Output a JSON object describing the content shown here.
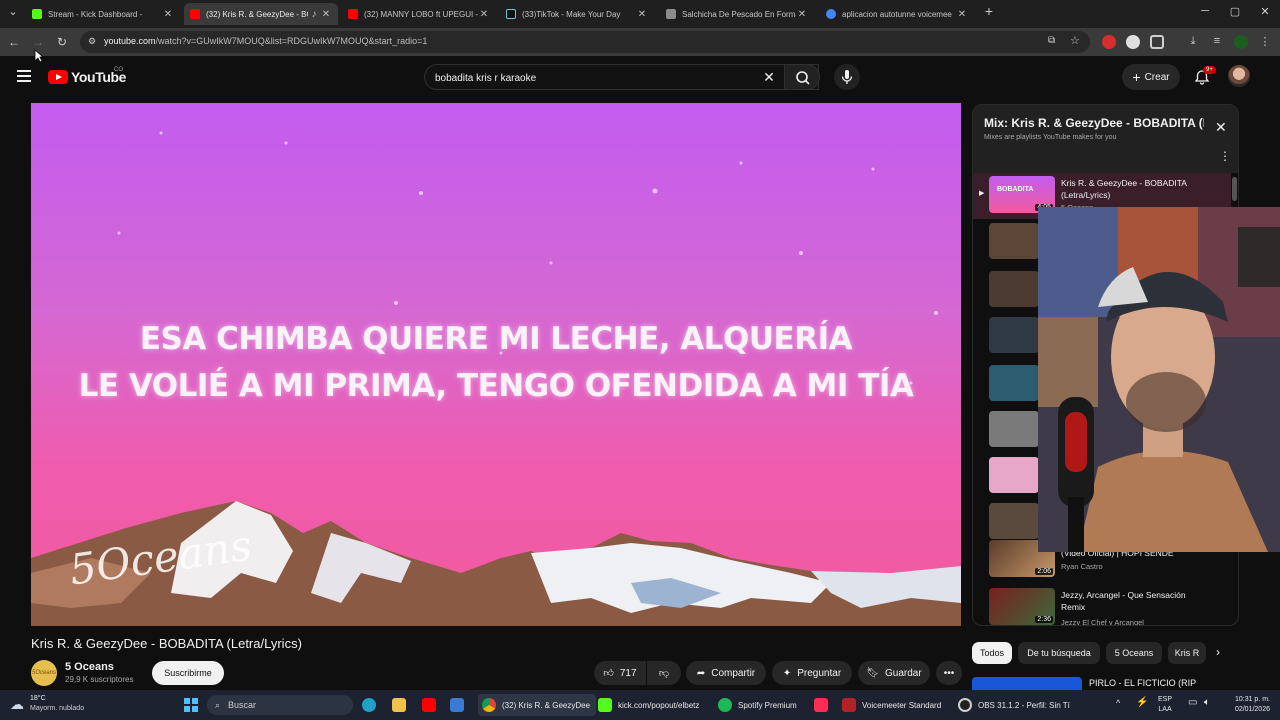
{
  "browser": {
    "tabs": [
      {
        "title": "Stream - Kick Dashboard -",
        "color": "#53fc18"
      },
      {
        "title": "(32) Kris R. & GeezyDee - BO",
        "color": "#ff0000",
        "active": true
      },
      {
        "title": "(32) MANNY LOBO ft UPEGUI -",
        "color": "#ff0000"
      },
      {
        "title": "(33)TikTok - Make Your Day",
        "color": "#ffffff"
      },
      {
        "title": "Salchicha De Pescado En Forma",
        "color": "#ffffff"
      },
      {
        "title": "aplicacion autotunne voicemee",
        "color": "#4285f4"
      }
    ],
    "url_host": "youtube.com",
    "url_path": "/watch?v=GUwIkW7MOUQ&list=RDGUwIkW7MOUQ&start_radio=1"
  },
  "youtube": {
    "logo_text": "YouTube",
    "country": "CO",
    "search_value": "bobadita kris r karaoke",
    "create_label": "Crear",
    "notif_count": "9+"
  },
  "video": {
    "lyric_line1": "ESA CHIMBA QUIERE MI LECHE, ALQUERÍA",
    "lyric_line2": "LE VOLIÉ A MI PRIMA, TENGO OFENDIDA A MI TÍA",
    "watermark": "5Oceans",
    "title": "Kris R. & GeezyDee - BOBADITA (Letra/Lyrics)",
    "channel": "5 Oceans",
    "subscribers": "29,9 K suscriptores",
    "subscribe_label": "Suscribirme",
    "likes": "717",
    "share_label": "Compartir",
    "ask_label": "Preguntar",
    "save_label": "Guardar"
  },
  "playlist": {
    "title": "Mix: Kris R. & GeezyDee - BOBADITA (Letra/Lyrics)",
    "subtitle": "Mixes are playlists YouTube makes for you",
    "items": [
      {
        "title": "Kris R. & GeezyDee - BOBADITA (Letra/Lyrics)",
        "channel": "5 Oceans",
        "duration": "4:05",
        "thumb": "BOBADITA"
      },
      {
        "title": "(Video Oficial) | HOPI SENDÉ",
        "channel": "Ryan Castro",
        "duration": "2:06"
      },
      {
        "title": "Jezzy, Arcangel - Que Sensación Remix",
        "channel": "Jezzy El Chef y Arcangel",
        "duration": "2:36"
      }
    ]
  },
  "chips": [
    "Todos",
    "De tu búsqueda",
    "5 Oceans",
    "Kris R"
  ],
  "next_rec": "PIRLO - EL FICTICIO (RIP",
  "taskbar": {
    "weather_temp": "18°C",
    "weather_desc": "Mayorm. nublado",
    "search_label": "Buscar",
    "apps": [
      {
        "label": "(32) Kris R. & GeezyDee"
      },
      {
        "label": "kick.com/popout/elbetz"
      },
      {
        "label": "Spotify Premium"
      },
      {
        "label": "Voicemeeter Standard"
      },
      {
        "label": "OBS 31.1.2 - Perfil: Sin Tí"
      }
    ],
    "lang_top": "ESP",
    "lang_bottom": "LAA",
    "time": "10:31 p. m.",
    "date": "02/01/2026"
  }
}
